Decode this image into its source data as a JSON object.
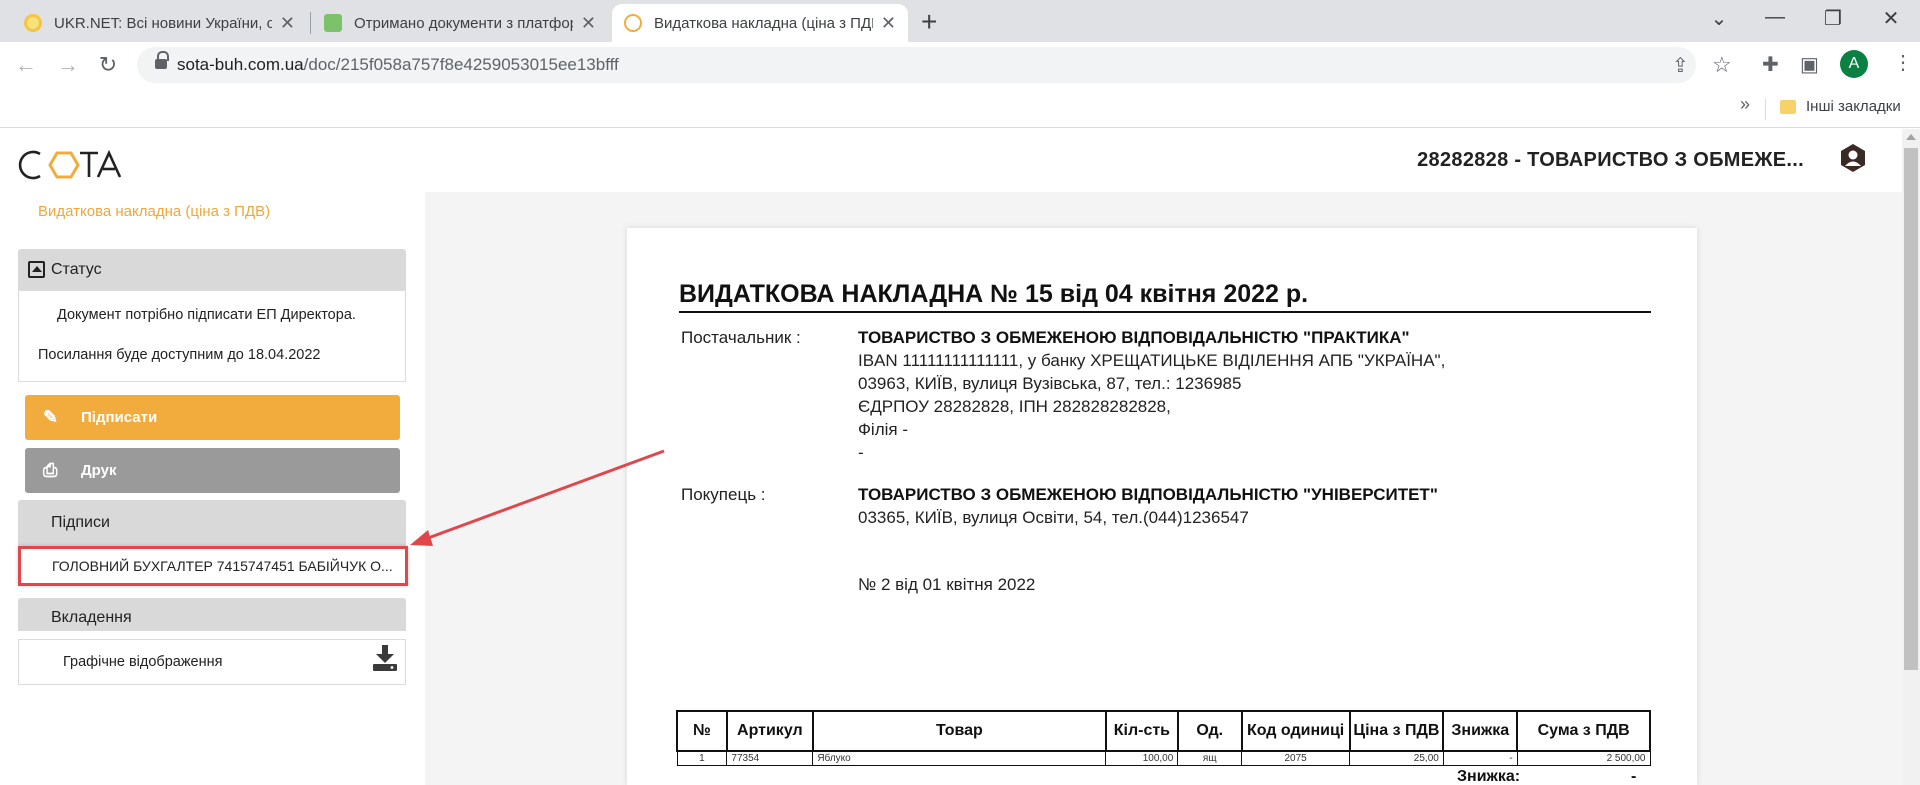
{
  "browser": {
    "tabs": [
      {
        "title": "UKR.NET: Всі новини України, ос",
        "close": "✕"
      },
      {
        "title": "Отримано документи з платфор",
        "close": "✕"
      },
      {
        "title": "Видаткова накладна (ціна з ПДВ",
        "close": "✕"
      }
    ],
    "new_tab": "+",
    "url_host": "sota-buh.com.ua",
    "url_path": "/doc/215f058a757f8e4259053015ee13bfff",
    "profile_initial": "A",
    "bookmarks_more": "»",
    "bookmarks_folder": "Інші закладки"
  },
  "app": {
    "logo": "СОТА",
    "company": "28282828 - ТОВАРИСТВО З ОБМЕЖЕ...",
    "breadcrumb": "Видаткова накладна (ціна з ПДВ)"
  },
  "sidebar": {
    "status_header": "Статус",
    "status_line1": "Документ потрібно підписати ЕП Директора.",
    "status_line2": "Посилання буде доступним до 18.04.2022",
    "sign_button": "Підписати",
    "print_button": "Друк",
    "signatures_header": "Підписи",
    "signature_item": "ГОЛОВНИЙ БУХГАЛТЕР 7415747451 БАБІЙЧУК О...",
    "attachments_header": "Вкладення",
    "attachment_item": "Графічне відображення"
  },
  "document": {
    "title": "ВИДАТКОВА НАКЛАДНА №  15 від 04 квітня 2022 р.",
    "supplier_label": "Постачальник :",
    "supplier_name": "ТОВАРИСТВО З ОБМЕЖЕНОЮ ВІДПОВІДАЛЬНІСТЮ \"ПРАКТИКА\"",
    "supplier_iban": "IBAN 11111111111111, у банку ХРЕЩАТИЦЬКЕ ВІДІЛЕННЯ АПБ \"УКРАЇНА\",",
    "supplier_address": "03963, КИЇВ, вулиця Вузівська, 87, тел.: 1236985",
    "supplier_codes": "ЄДРПОУ 28282828, ІПН 282828282828,",
    "supplier_branch": "Філія -",
    "supplier_dash": "-",
    "buyer_label": "Покупець :",
    "buyer_name": "ТОВАРИСТВО З ОБМЕЖЕНОЮ ВІДПОВІДАЛЬНІСТЮ \"УНІВЕРСИТЕТ\"",
    "buyer_address": "03365, КИЇВ, вулиця Освіти, 54, тел.(044)1236547",
    "contract": "№ 2 від 01 квітня 2022",
    "table_headers": [
      "№",
      "Артикул",
      "Товар",
      "Кіл-сть",
      "Од.",
      "Код одиниці",
      "Ціна з ПДВ",
      "Знижка",
      "Сума з ПДВ"
    ],
    "row": [
      "1",
      "77354",
      "Яблуко",
      "100,00",
      "ящ",
      "2075",
      "25,00",
      "-",
      "2 500,00"
    ],
    "discount_label": "Знижка:",
    "discount_value": "-"
  }
}
